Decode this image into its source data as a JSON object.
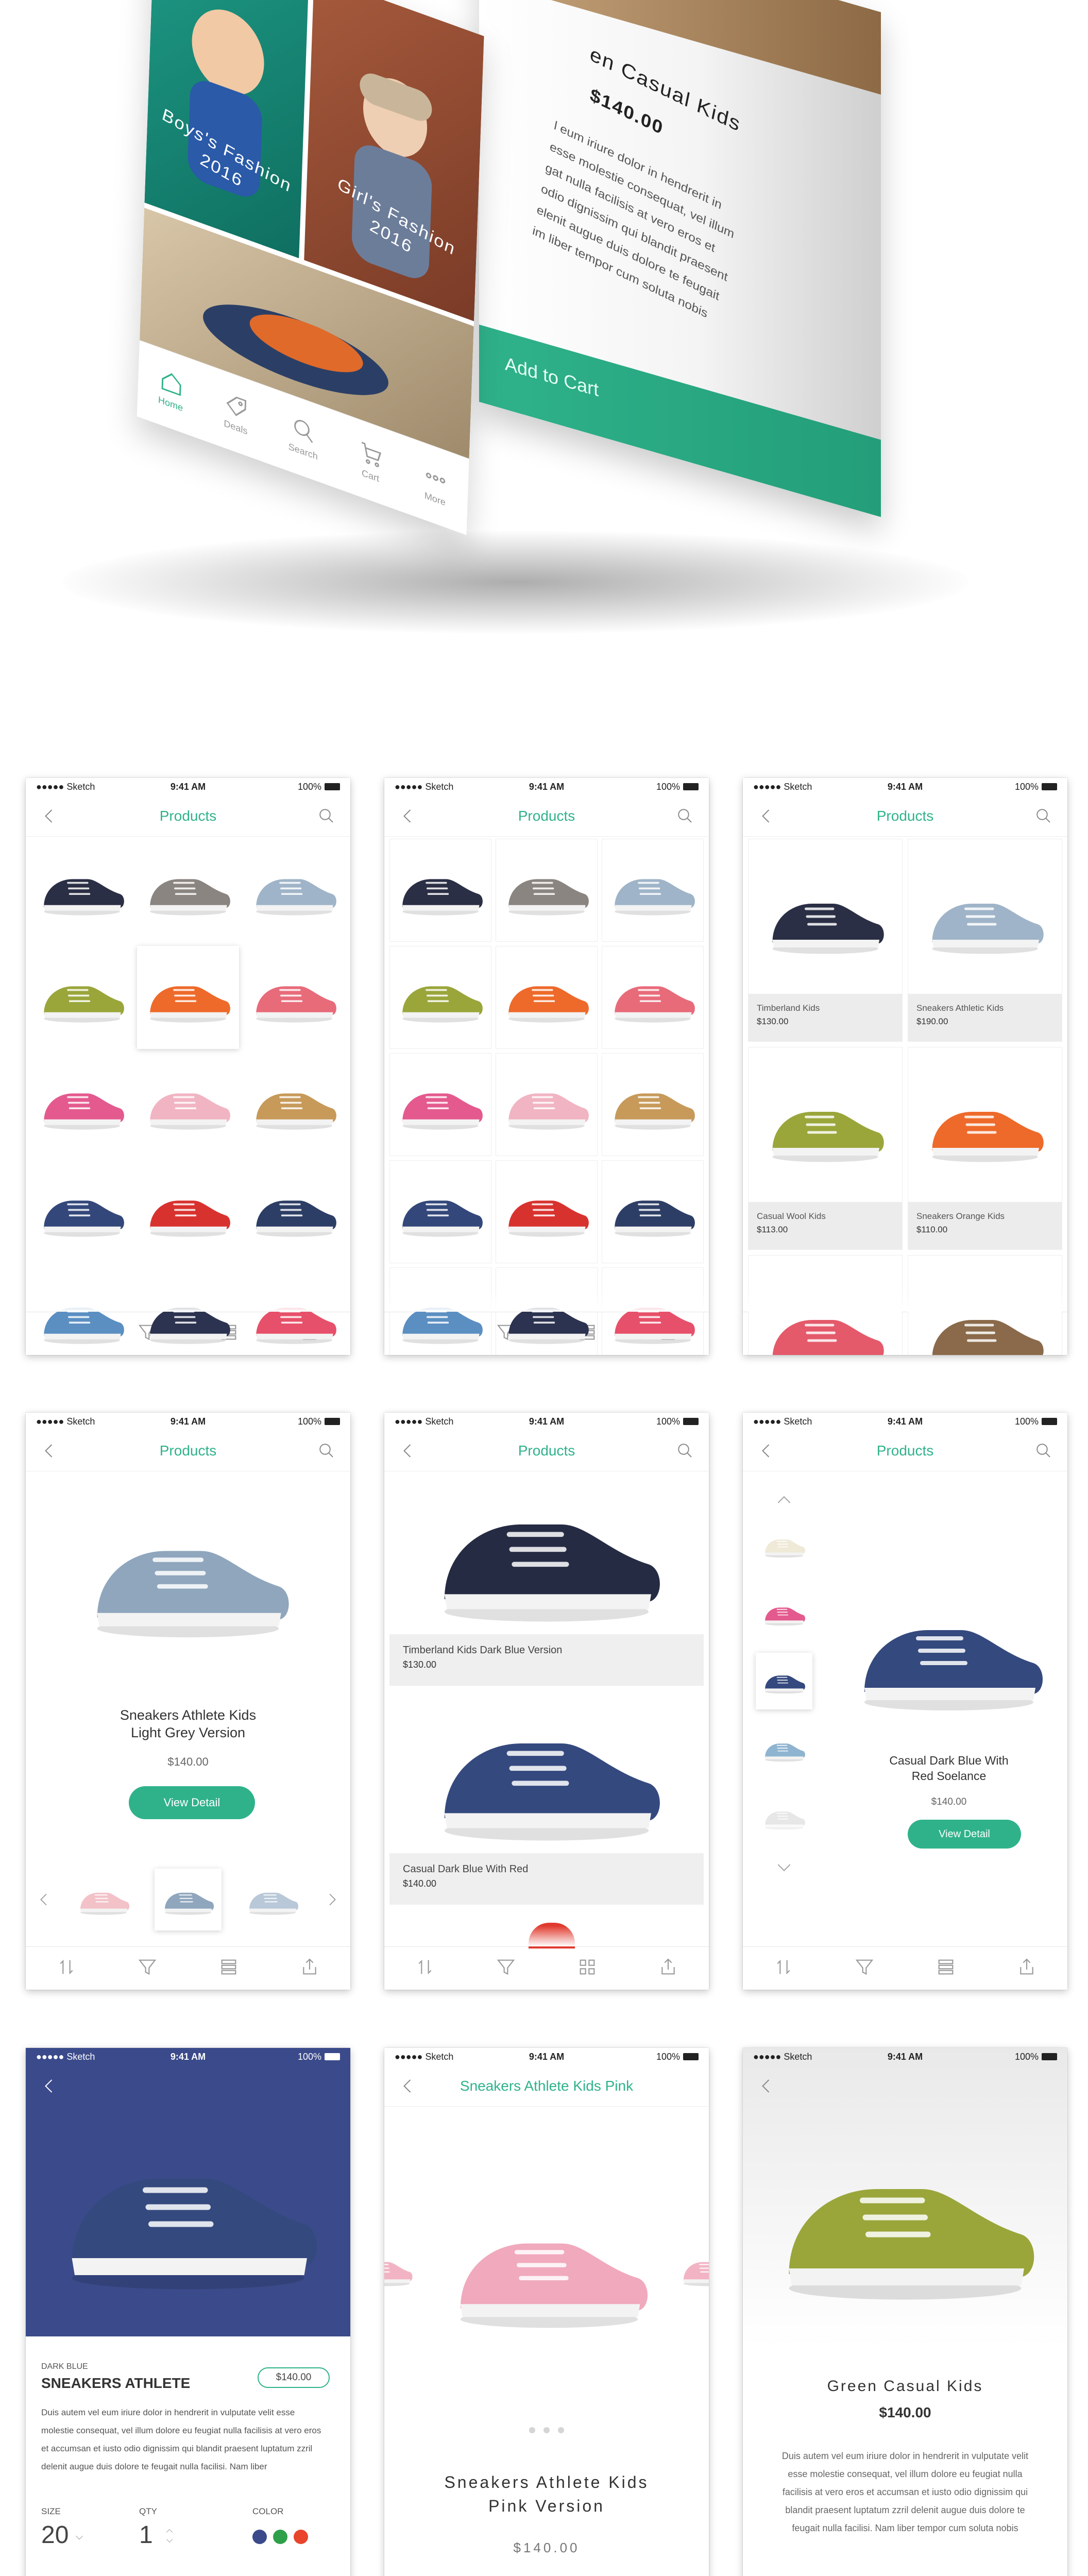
{
  "hero": {
    "captions": [
      {
        "line1": "Boys's Fashion",
        "line2": "2016"
      },
      {
        "line1": "Girl's Fashion",
        "line2": "2016"
      }
    ],
    "tabs": [
      "Home",
      "Deals",
      "Search",
      "Cart",
      "More"
    ],
    "detail_title": "en Casual Kids",
    "detail_price": "$140.00",
    "detail_body": [
      "l eum iriure dolor in hendrerit in",
      "esse molestie consequat, vel illum",
      "gat nulla facilisis at vero eros et",
      "odio dignissim qui blandit praesent",
      "elenit augue duis dolore te feugait",
      "im liber tempor cum soluta nobis"
    ],
    "add_to_cart": "Add to Cart"
  },
  "status": {
    "carrier": "●●●●● Sketch",
    "time": "9:41 AM",
    "battery": "100%"
  },
  "nav_title": "Products",
  "screen3": {
    "items": [
      {
        "name": "Timberland Kids",
        "price": "$130.00"
      },
      {
        "name": "Sneakers Athletic Kids",
        "price": "$190.00"
      },
      {
        "name": "Casual Wool Kids",
        "price": "$113.00"
      },
      {
        "name": "Sneakers Orange Kids",
        "price": "$110.00"
      }
    ]
  },
  "screen4": {
    "title_line1": "Sneakers Athlete Kids",
    "title_line2": "Light Grey Version",
    "price": "$140.00",
    "button": "View Detail"
  },
  "screen5": {
    "items": [
      {
        "name": "Timberland Kids Dark Blue Version",
        "price": "$130.00"
      },
      {
        "name": "Casual Dark Blue With Red",
        "price": "$140.00"
      }
    ]
  },
  "screen6": {
    "title_line1": "Casual Dark Blue With",
    "title_line2": "Red Soelance",
    "price": "$140.00",
    "button": "View Detail"
  },
  "screen7": {
    "eyebrow": "DARK BLUE",
    "title": "SNEAKERS ATHLETE",
    "price": "$140.00",
    "body": "Duis autem vel eum iriure dolor in hendrerit in vulputate velit esse molestie consequat, vel illum dolore eu feugiat nulla facilisis at vero eros et accumsan et iusto odio dignissim qui blandit praesent luptatum zzril delenit augue duis dolore te feugait nulla facilisi. Nam liber",
    "size_label": "SIZE",
    "size_value": "20",
    "qty_label": "QTY",
    "qty_value": "1",
    "color_label": "COLOR",
    "colors": [
      "#3b4a8a",
      "#2fa04a",
      "#e8452c"
    ]
  },
  "screen8": {
    "nav_title": "Sneakers Athlete Kids Pink",
    "title_line1": "Sneakers Athlete Kids",
    "title_line2": "Pink Version",
    "price": "$140.00"
  },
  "screen9": {
    "title": "Green Casual Kids",
    "price": "$140.00",
    "body": "Duis autem vel eum iriure dolor in hendrerit in vulputate velit esse molestie consequat, vel illum dolore eu feugiat nulla facilisis at vero eros et accumsan et iusto odio dignissim qui blandit praesent luptatum zzril delenit augue duis dolore te feugait nulla facilisi. Nam liber tempor cum soluta nobis"
  },
  "colors": {
    "accent": "#2fb28a",
    "hero_blue": "#3b4a8a"
  }
}
